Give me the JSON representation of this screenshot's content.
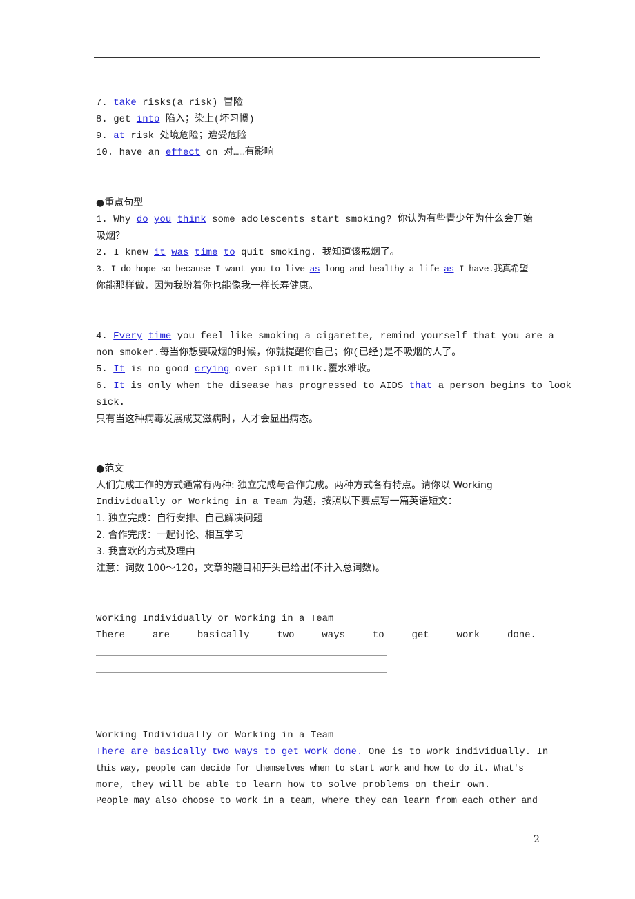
{
  "phrases": [
    {
      "num": "7.",
      "parts": [
        {
          "t": "take",
          "u": true
        },
        {
          "t": " risks(a risk)  冒险"
        }
      ]
    },
    {
      "num": "8.",
      "parts": [
        {
          "t": "get "
        },
        {
          "t": "into",
          "u": true
        },
        {
          "t": "  陷入；染上(坏习惯)"
        }
      ]
    },
    {
      "num": "9.",
      "parts": [
        {
          "t": "at",
          "u": true
        },
        {
          "t": " risk  处境危险；遭受危险"
        }
      ]
    },
    {
      "num": "10.",
      "parts": [
        {
          "t": "have an "
        },
        {
          "t": "effect",
          "u": true
        },
        {
          "t": " on  对……有影响"
        }
      ]
    }
  ],
  "sentences_heading": "●重点句型",
  "s1a": "1. Why ",
  "s1u1": "do",
  "s1u2": "you",
  "s1u3": "think",
  "s1b": " some adolescents start smoking? 你认为有些青少年为什么会开始",
  "s1c": "吸烟？",
  "s2a": "2. I knew ",
  "s2u1": "it",
  "s2u2": "was",
  "s2u3": "time",
  "s2u4": "to",
  "s2b": " quit smoking. 我知道该戒烟了。",
  "s3a": "3. I do hope so because I want you to live ",
  "s3u1": "as",
  "s3b": " long and healthy a life ",
  "s3u2": "as",
  "s3c": " I have.我真希望",
  "s3d": "你能那样做，因为我盼着你也能像我一样长寿健康。",
  "s4a": "4. ",
  "s4u1": "Every",
  "s4u2": "time",
  "s4b": " you feel like smoking a cigarette, remind yourself that you are a",
  "s4c": "non  smoker.每当你想要吸烟的时候，你就提醒你自己；你(已经)是不吸烟的人了。",
  "s5a": "5. ",
  "s5u1": "It",
  "s5b": " is no good ",
  "s5u2": "crying",
  "s5c": " over spilt milk.覆水难收。",
  "s6a": "6. ",
  "s6u1": "It",
  "s6b": " is only when the disease has progressed to AIDS ",
  "s6u2": "that",
  "s6c": " a person begins to look",
  "s6d": "sick.",
  "s6e": "只有当这种病毒发展成艾滋病时，人才会显出病态。",
  "essay_heading": "●范文",
  "prompt1": "人们完成工作的方式通常有两种: 独立完成与合作完成。两种方式各有特点。请你以 Working",
  "prompt2": "Individually or Working in a Team 为题，按照以下要点写一篇英语短文：",
  "prompt3": "1. 独立完成：自行安排、自己解决问题",
  "prompt4": "2. 合作完成：一起讨论、相互学习",
  "prompt5": "3. 我喜欢的方式及理由",
  "prompt6": "注意：词数 100～120，文章的题目和开头已给出(不计入总词数)。",
  "exercise_title": "Working Individually or Working in a Team",
  "exercise_words": [
    "There",
    "are",
    "basically",
    "two",
    "ways",
    "to",
    "get",
    "work",
    "done."
  ],
  "answer_title": "Working Individually or Working in a Team",
  "answer_u": "There are basically two ways to get work done.",
  "answer1b": " One is to work individually.  In",
  "answer2": "this way, people can decide for themselves when to start work and how to do it. What's",
  "answer3": "more, they will be able to learn how to solve problems on their own.",
  "answer4": "People may also choose to work in a team, where they can learn from each other and",
  "page_number": "2"
}
